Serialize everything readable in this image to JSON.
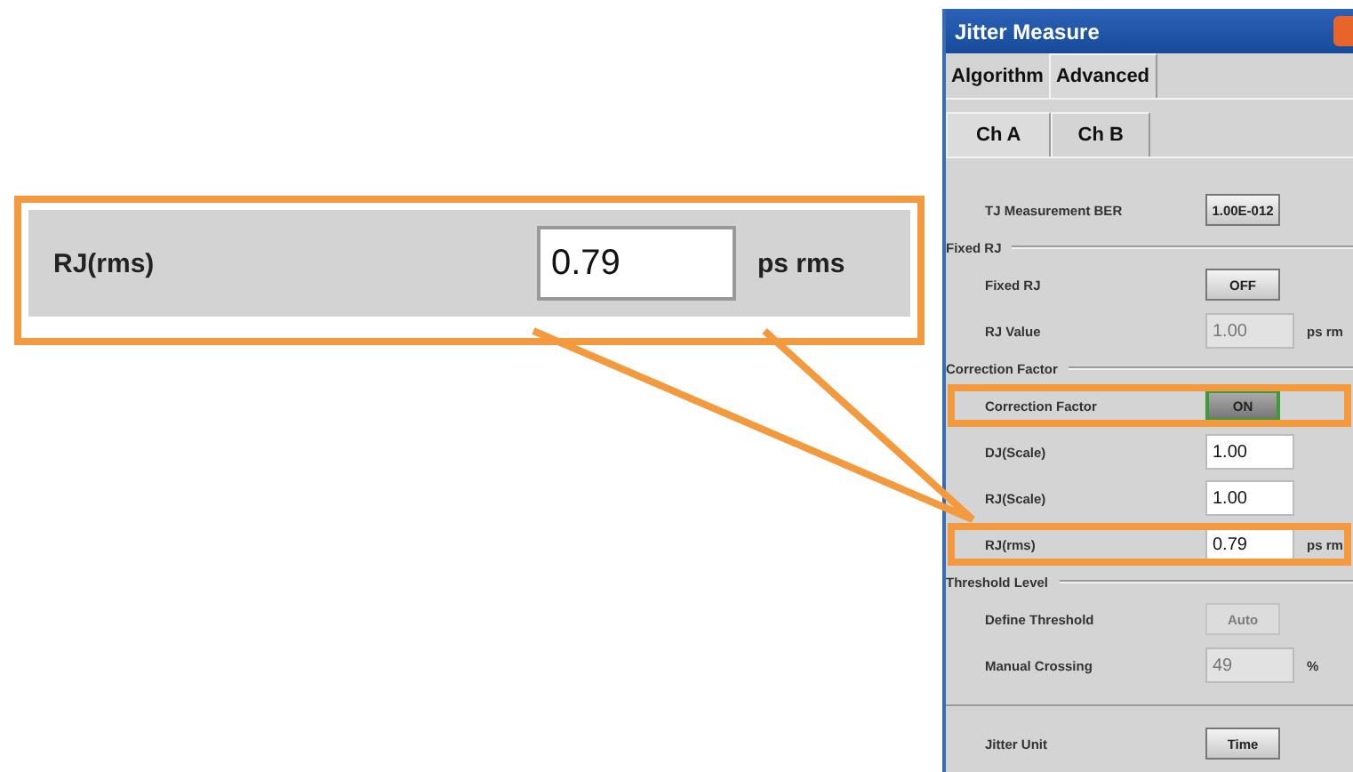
{
  "callout": {
    "label": "RJ(rms)",
    "value": "0.79",
    "unit": "ps rms"
  },
  "dialog": {
    "title": "Jitter Measure",
    "tabs": [
      {
        "label": "Algorithm",
        "selected": false
      },
      {
        "label": "Advanced",
        "selected": true
      }
    ],
    "subtabs": [
      {
        "label": "Ch A",
        "selected": true
      },
      {
        "label": "Ch B",
        "selected": false
      }
    ],
    "items": [
      {
        "kind": "button",
        "label": "TJ Measurement BER",
        "value": "1.00E-012",
        "disabled": false,
        "active": false,
        "highlighted": false
      },
      {
        "kind": "group",
        "label": "Fixed RJ"
      },
      {
        "kind": "button",
        "label": "Fixed RJ",
        "value": "OFF",
        "disabled": false,
        "active": false,
        "highlighted": false
      },
      {
        "kind": "field",
        "label": "RJ Value",
        "value": "1.00",
        "unit": "ps rm",
        "disabled": true,
        "highlighted": false
      },
      {
        "kind": "group",
        "label": "Correction Factor"
      },
      {
        "kind": "button",
        "label": "Correction Factor",
        "value": "ON",
        "disabled": false,
        "active": true,
        "highlighted": true
      },
      {
        "kind": "field",
        "label": "DJ(Scale)",
        "value": "1.00",
        "disabled": false,
        "highlighted": false
      },
      {
        "kind": "field",
        "label": "RJ(Scale)",
        "value": "1.00",
        "disabled": false,
        "highlighted": false
      },
      {
        "kind": "field",
        "label": "RJ(rms)",
        "value": "0.79",
        "unit": "ps rm",
        "disabled": false,
        "highlighted": true
      },
      {
        "kind": "group",
        "label": "Threshold Level"
      },
      {
        "kind": "button",
        "label": "Define Threshold",
        "value": "Auto",
        "disabled": true,
        "active": false,
        "highlighted": false
      },
      {
        "kind": "field",
        "label": "Manual Crossing",
        "value": "49",
        "unit": "%",
        "disabled": true,
        "highlighted": false
      },
      {
        "kind": "divider"
      },
      {
        "kind": "button",
        "label": "Jitter Unit",
        "value": "Time",
        "disabled": false,
        "active": false,
        "highlighted": false
      }
    ]
  }
}
